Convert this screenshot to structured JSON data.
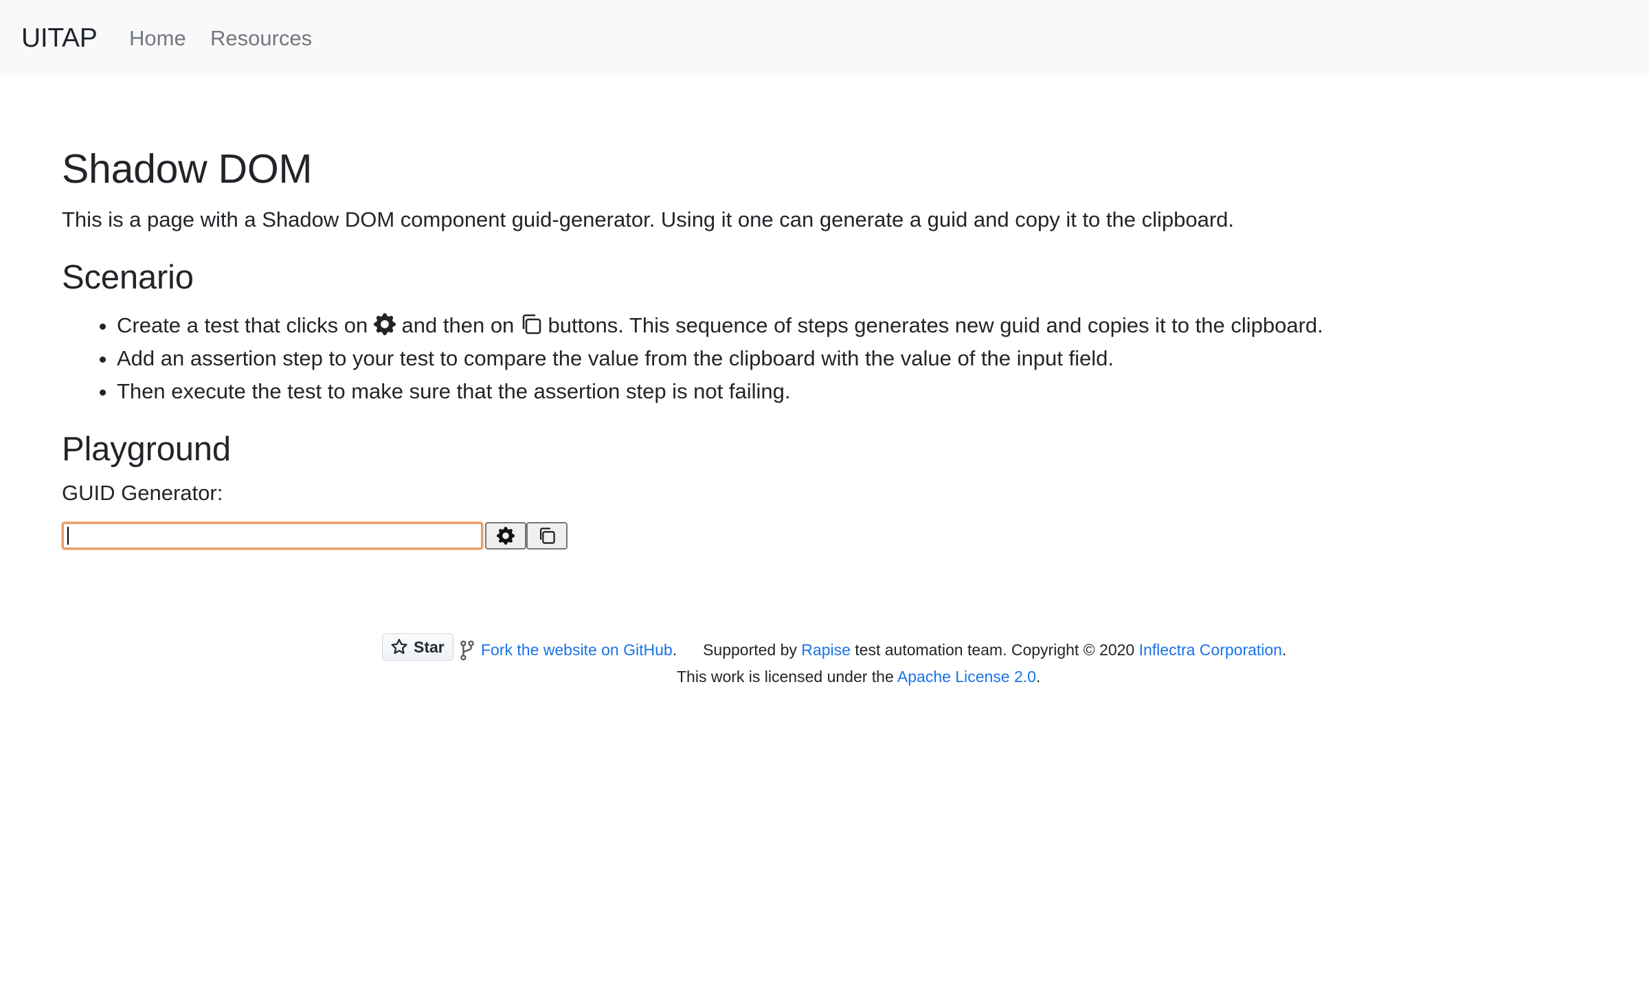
{
  "navbar": {
    "brand": "UITAP",
    "links": [
      "Home",
      "Resources"
    ]
  },
  "main": {
    "title": "Shadow DOM",
    "description": "This is a page with a Shadow DOM component guid-generator. Using it one can generate a guid and copy it to the clipboard.",
    "scenario_heading": "Scenario",
    "steps": {
      "step1_part1": "Create a test that clicks on",
      "step1_part2": "and then on",
      "step1_part3": "buttons. This sequence of steps generates new guid and copies it to the clipboard.",
      "step2": "Add an assertion step to your test to compare the value from the clipboard with the value of the input field.",
      "step3": "Then execute the test to make sure that the assertion step is not failing."
    },
    "playground_heading": "Playground",
    "guid_label": "GUID Generator:",
    "guid_value": "",
    "generate_icon": "gear-icon",
    "copy_icon": "copy-icon"
  },
  "footer": {
    "star_label": "Star",
    "star_icon": "star-icon",
    "fork_icon": "fork-icon",
    "fork_link": "Fork the website on GitHub",
    "fork_suffix": ".",
    "supported_prefix": "Supported by",
    "rapise_link": "Rapise",
    "supported_middle": "test automation team. Copyright © 2020",
    "inflectra_link": "Inflectra Corporation",
    "supported_suffix": ".",
    "license_prefix": "This work is licensed under the",
    "license_link": "Apache License 2.0",
    "license_suffix": "."
  },
  "colors": {
    "navbar_bg": "#f8f9fa",
    "link": "#1a73e8",
    "input_focus_border": "#e8a06b",
    "text": "#212529"
  }
}
